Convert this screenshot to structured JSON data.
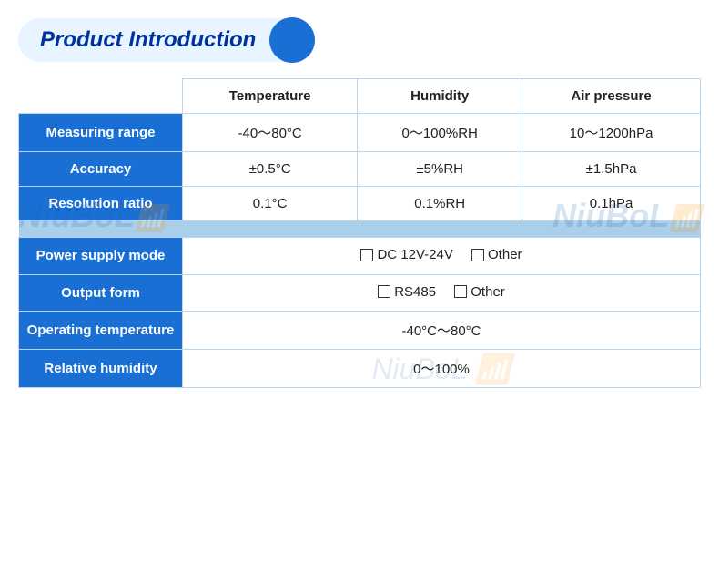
{
  "header": {
    "title": "Product Introduction"
  },
  "watermark": "NiuBoL",
  "table": {
    "columns": [
      "",
      "Temperature",
      "Humidity",
      "Air pressure"
    ],
    "rows": [
      {
        "label": "Measuring range",
        "temp": "-40～80°C",
        "humidity": "0～100%RH",
        "pressure": "10～1200hPa"
      },
      {
        "label": "Accuracy",
        "temp": "±0.5°C",
        "humidity": "±5%RH",
        "pressure": "±1.5hPa"
      },
      {
        "label": "Resolution ratio",
        "temp": "0.1°C",
        "humidity": "0.1%RH",
        "pressure": "0.1hPa"
      }
    ]
  },
  "bottom_rows": [
    {
      "label": "Power supply mode",
      "value_type": "checkboxes",
      "options": [
        "DC 12V-24V",
        "Other"
      ]
    },
    {
      "label": "Output form",
      "value_type": "checkboxes",
      "options": [
        "RS485",
        "Other"
      ]
    },
    {
      "label": "Operating temperature",
      "value_type": "text",
      "value": "-40°C～80°C"
    },
    {
      "label": "Relative humidity",
      "value_type": "text",
      "value": "0～100%"
    }
  ]
}
